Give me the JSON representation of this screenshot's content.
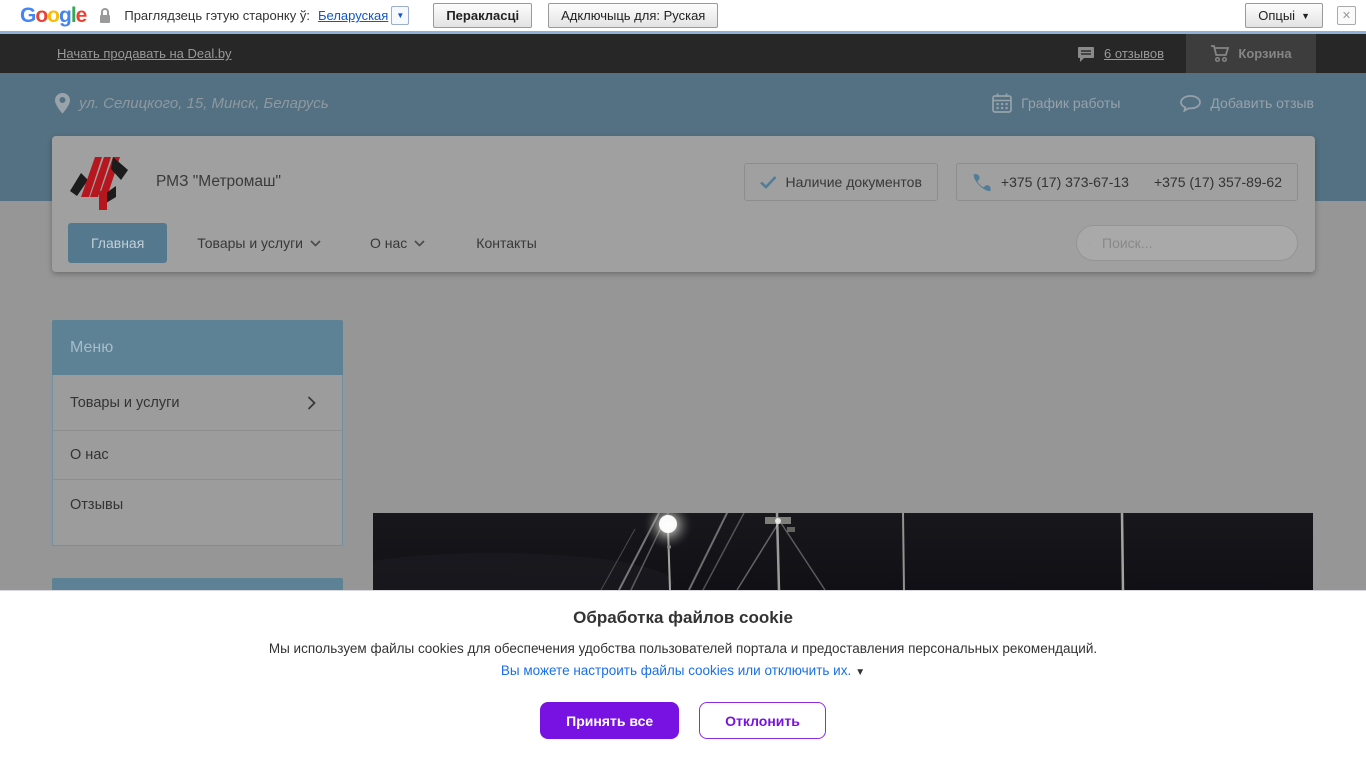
{
  "translate_bar": {
    "logo_letters": [
      "G",
      "o",
      "o",
      "g",
      "l",
      "e"
    ],
    "prompt": "Праглядзець гэтую старонку ў:",
    "language": "Беларуская",
    "language_caret": "▼",
    "translate_button": "Перакласці",
    "disable_button": "Адключыць для: Руская",
    "options_button": "Опцыі",
    "options_caret": "▼",
    "close_glyph": "✕"
  },
  "deal_bar": {
    "sell_link": "Начать продавать на Deal.by",
    "reviews_link": "6 отзывов",
    "cart_label": "Корзина"
  },
  "address_bar": {
    "address": "ул. Селицкого, 15, Минск, Беларусь",
    "schedule_label": "График работы",
    "add_review_label": "Добавить отзыв"
  },
  "company": {
    "name": "РМЗ \"Метромаш\"",
    "documents_label": "Наличие документов",
    "phones": [
      "+375 (17) 373-67-13",
      "+375 (17) 357-89-62"
    ]
  },
  "nav": {
    "home": "Главная",
    "products": "Товары и услуги",
    "about": "О нас",
    "contacts": "Контакты",
    "search_placeholder": "Поиск..."
  },
  "sidebar": {
    "title": "Меню",
    "items": [
      "Товары и услуги",
      "О нас",
      "Отзывы"
    ]
  },
  "cookie_dialog": {
    "title": "Обработка файлов cookie",
    "message": "Мы используем файлы cookies для обеспечения удобства пользователей портала и предоставления персональных рекомендаций.",
    "settings_link": "Вы можете настроить файлы cookies или отключить их.",
    "settings_caret": "▼",
    "accept_button": "Принять все",
    "decline_button": "Отклонить"
  },
  "colors": {
    "accent_teal": "#547183",
    "menu_teal": "#5d8295",
    "brand_purple": "#7712e2",
    "link_blue": "#1a6fe8",
    "logo_red": "#b6171e",
    "dark_bar": "#272727"
  }
}
